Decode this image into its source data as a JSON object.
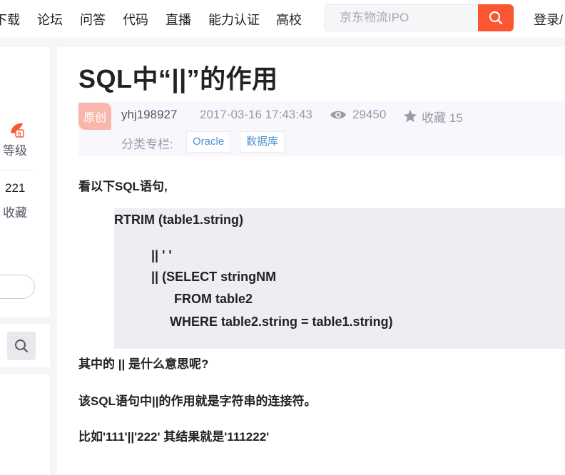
{
  "nav": {
    "items": [
      "下载",
      "论坛",
      "问答",
      "代码",
      "直播",
      "能力认证",
      "高校"
    ],
    "search_placeholder": "京东物流IPO",
    "login": "登录/"
  },
  "sidebar": {
    "level_label": "等级",
    "fav_count": "221",
    "fav_label": "收藏"
  },
  "article": {
    "title": "SQL中“||”的作用",
    "badge": "原创",
    "author": "yhj198927",
    "time": "2017-03-16 17:43:43",
    "views": "29450",
    "favorites": "收藏 15",
    "category_label": "分类专栏:",
    "tags": [
      "Oracle",
      "数据库"
    ],
    "paragraph1": "看以下SQL语句,",
    "code_lines": [
      "RTRIM (table1.string)",
      "|| ' '",
      "|| (SELECT stringNM",
      "FROM table2",
      "WHERE table2.string = table1.string)"
    ],
    "paragraph2": "其中的 || 是什么意思呢?",
    "paragraph3": "该SQL语句中||的作用就是字符串的连接符。",
    "paragraph4": "比如'111'||'222' 其结果就是'111222'"
  },
  "colors": {
    "accent": "#fc5531",
    "badge": "#f9b7ab",
    "tag_text": "#5094d5",
    "code_bg": "#eeeef2"
  },
  "icons": [
    "search-icon",
    "level-icon",
    "eye-icon",
    "star-icon"
  ]
}
